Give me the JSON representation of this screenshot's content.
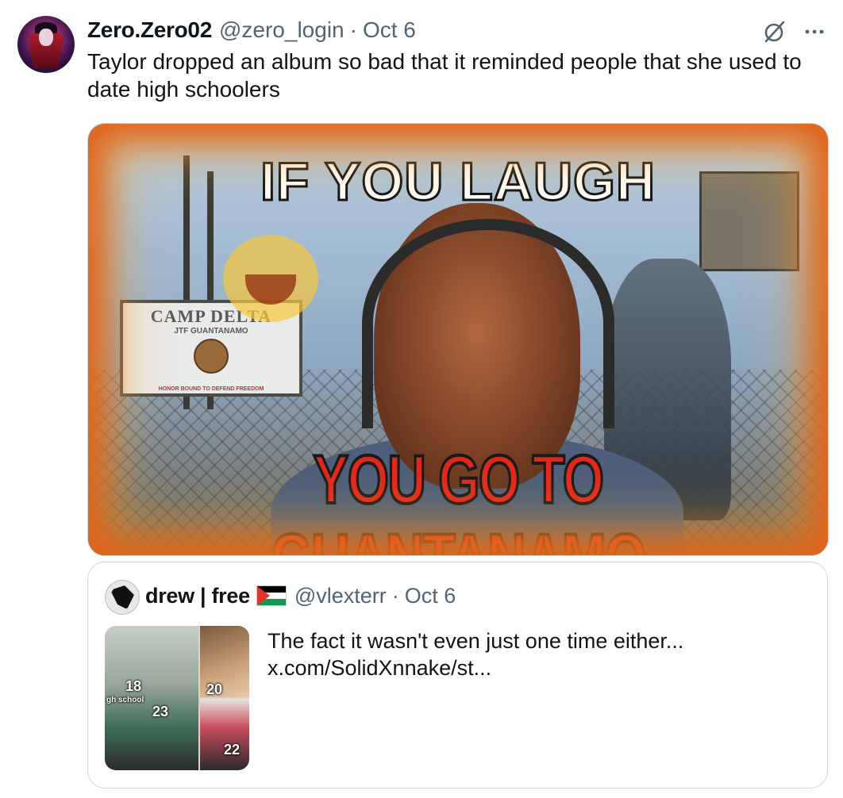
{
  "tweet": {
    "author_name": "Zero.Zero02",
    "author_handle": "@zero_login",
    "separator": "·",
    "date": "Oct 6",
    "text": "Taylor dropped an album so bad that it reminded people that she used to date high schoolers",
    "media": {
      "top_caption": "IF YOU LAUGH",
      "bottom_caption": "YOU GO TO GUANTANAMO",
      "sign_line1": "CAMP DELTA",
      "sign_line2": "JTF GUANTANAMO",
      "sign_line3": "HONOR BOUND TO DEFEND FREEDOM"
    },
    "icons": {
      "grok": "grok-slash-icon",
      "more": "more-horizontal-icon"
    }
  },
  "quote": {
    "author_name": "drew | free",
    "flag": "palestine-flag-icon",
    "author_handle": "@vlexterr",
    "separator": "·",
    "date": "Oct 6",
    "text_line1": "The fact it wasn't even just one time either...",
    "text_line2": "x.com/SolidXnnake/st...",
    "thumb_labels": {
      "a": "18",
      "a_sub": "gh school",
      "b": "23",
      "c": "20",
      "d": "22"
    }
  },
  "colors": {
    "text": "#0f1419",
    "muted": "#536471",
    "border": "#cfd9de",
    "caption_red": "#e1281b"
  }
}
